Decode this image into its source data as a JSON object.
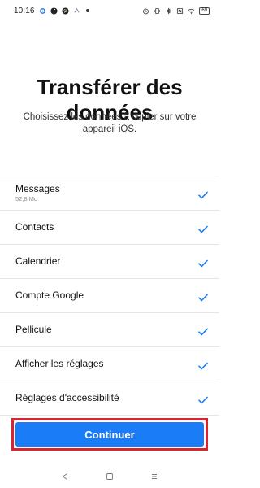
{
  "status_bar": {
    "time": "10:16",
    "battery": "69",
    "icons": [
      "settings-icon",
      "facebook-icon",
      "pinterest-icon",
      "app-icon",
      "dot-icon",
      "alarm-icon",
      "vibrate-icon",
      "bluetooth-icon",
      "nfc-icon",
      "wifi-icon",
      "battery-icon"
    ]
  },
  "header": {
    "title": "Transférer des données",
    "subtitle": "Choisissez les données à copier sur votre appareil iOS."
  },
  "items": [
    {
      "label": "Messages",
      "sub": "52,8 Mo",
      "checked": true
    },
    {
      "label": "Contacts",
      "sub": "",
      "checked": true
    },
    {
      "label": "Calendrier",
      "sub": "",
      "checked": true
    },
    {
      "label": "Compte Google",
      "sub": "",
      "checked": true
    },
    {
      "label": "Pellicule",
      "sub": "",
      "checked": true
    },
    {
      "label": "Afficher les réglages",
      "sub": "",
      "checked": true
    },
    {
      "label": "Réglages d'accessibilité",
      "sub": "",
      "checked": true
    }
  ],
  "actions": {
    "continue_label": "Continuer"
  },
  "colors": {
    "accent": "#1a7cf7",
    "highlight_border": "#d9252f"
  },
  "nav": {
    "icons": [
      "back-icon",
      "home-icon",
      "recents-icon"
    ]
  }
}
